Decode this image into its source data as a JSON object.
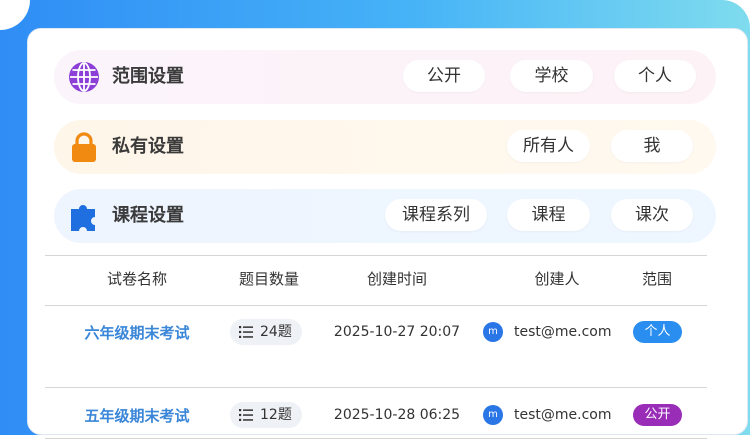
{
  "settings": {
    "scope": {
      "label": "范围设置",
      "icon": "globe-icon",
      "options": [
        "公开",
        "学校",
        "个人"
      ]
    },
    "private": {
      "label": "私有设置",
      "icon": "lock-icon",
      "options": [
        "所有人",
        "我"
      ]
    },
    "course": {
      "label": "课程设置",
      "icon": "puzzle-icon",
      "options": [
        "课程系列",
        "课程",
        "课次"
      ]
    }
  },
  "table": {
    "headers": [
      "试卷名称",
      "题目数量",
      "创建时间",
      "创建人",
      "范围"
    ],
    "rows": [
      {
        "name": "六年级期末考试",
        "count": "24题",
        "time": "2025-10-27 20:07",
        "avatar": "m",
        "creator": "test@me.com",
        "scope": "个人",
        "scope_color": "#2a8ef0"
      },
      {
        "name": "五年级期末考试",
        "count": "12题",
        "time": "2025-10-28 06:25",
        "avatar": "m",
        "creator": "test@me.com",
        "scope": "公开",
        "scope_color": "#9a2db8"
      }
    ]
  },
  "colors": {
    "accent": "#3a86d8",
    "globe": "#8b3fd6",
    "lock": "#f08a10",
    "puzzle": "#1f6fe0"
  }
}
